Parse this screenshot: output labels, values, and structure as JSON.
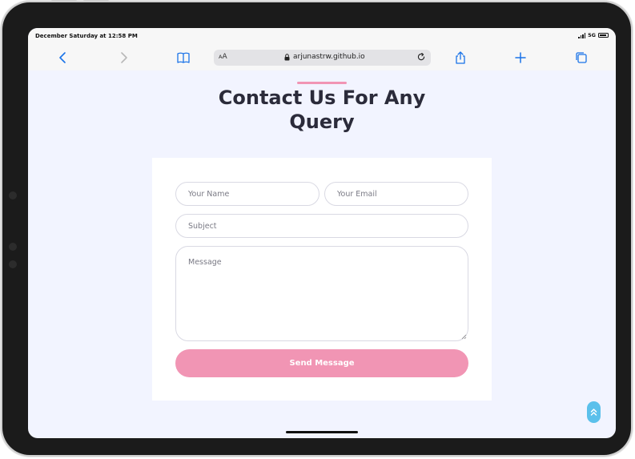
{
  "status_bar": {
    "time": "December Saturday at 12:58 PM",
    "network": "5G"
  },
  "browser": {
    "text_size_label_small": "A",
    "text_size_label_large": "A",
    "url": "arjunastrw.github.io"
  },
  "page": {
    "title": "Contact Us For Any Query",
    "accent_color": "#f195b4"
  },
  "form": {
    "name_placeholder": "Your Name",
    "email_placeholder": "Your Email",
    "subject_placeholder": "Subject",
    "message_placeholder": "Message",
    "submit_label": "Send Message"
  },
  "icons": {
    "back": "chevron-left-icon",
    "forward": "chevron-right-icon",
    "bookmarks": "book-icon",
    "lock": "lock-icon",
    "reload": "reload-icon",
    "share": "share-icon",
    "new_tab": "plus-icon",
    "tabs": "tabs-icon",
    "back_to_top": "double-chevron-up-icon"
  },
  "colors": {
    "browser_blue": "#1a73e8",
    "back_to_top": "#5bc0eb",
    "page_background": "#f2f4ff"
  }
}
